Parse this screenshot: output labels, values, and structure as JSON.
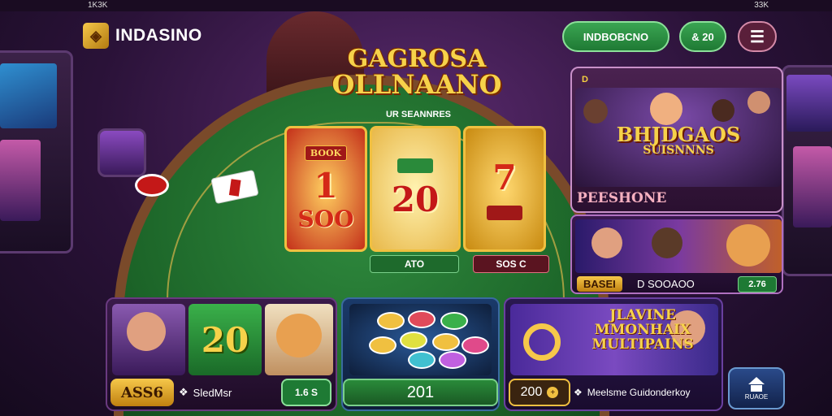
{
  "statusbar": {
    "left_time": "1K3K",
    "right_text": "33K"
  },
  "app": {
    "logo_text": "INDASINO"
  },
  "header": {
    "balance_button": "INDBOBCNO",
    "chips_button": "& 20",
    "menu_icon": "menu-icon"
  },
  "game": {
    "title_line1": "GAGROSA",
    "title_line2": "OLLNAANO",
    "subtitle": "UR SEANNRES",
    "reels": [
      {
        "badge": "BOOK",
        "big": "1",
        "small": "SOO"
      },
      {
        "big": "20"
      },
      {
        "big": "7"
      }
    ],
    "under_buttons": [
      "ATO",
      "SOS C"
    ]
  },
  "promo_panel": {
    "tag": "D",
    "title": "BHJDGAOS",
    "subtitle": "SUISNNNS",
    "label": "PEESHONE"
  },
  "promo_panel2": {
    "badge": "BASEI",
    "value": "D SOOAOO",
    "button": "2.76"
  },
  "bottom": {
    "card1": {
      "badge": "ASS6",
      "label": "SledMsr",
      "button": "1.6 S",
      "number": "20"
    },
    "card2": {
      "label": "201"
    },
    "card3": {
      "title": "JLAVINE MMONHAIX MULTIPAINS",
      "amount": "200",
      "label": "Meelsme Guidonderkoy"
    },
    "home": {
      "label": "RUAOE"
    }
  },
  "colors": {
    "accent": "#f6c84a",
    "felt": "#1c6428",
    "background": "#2a1238",
    "button_green": "#1f7a34"
  }
}
